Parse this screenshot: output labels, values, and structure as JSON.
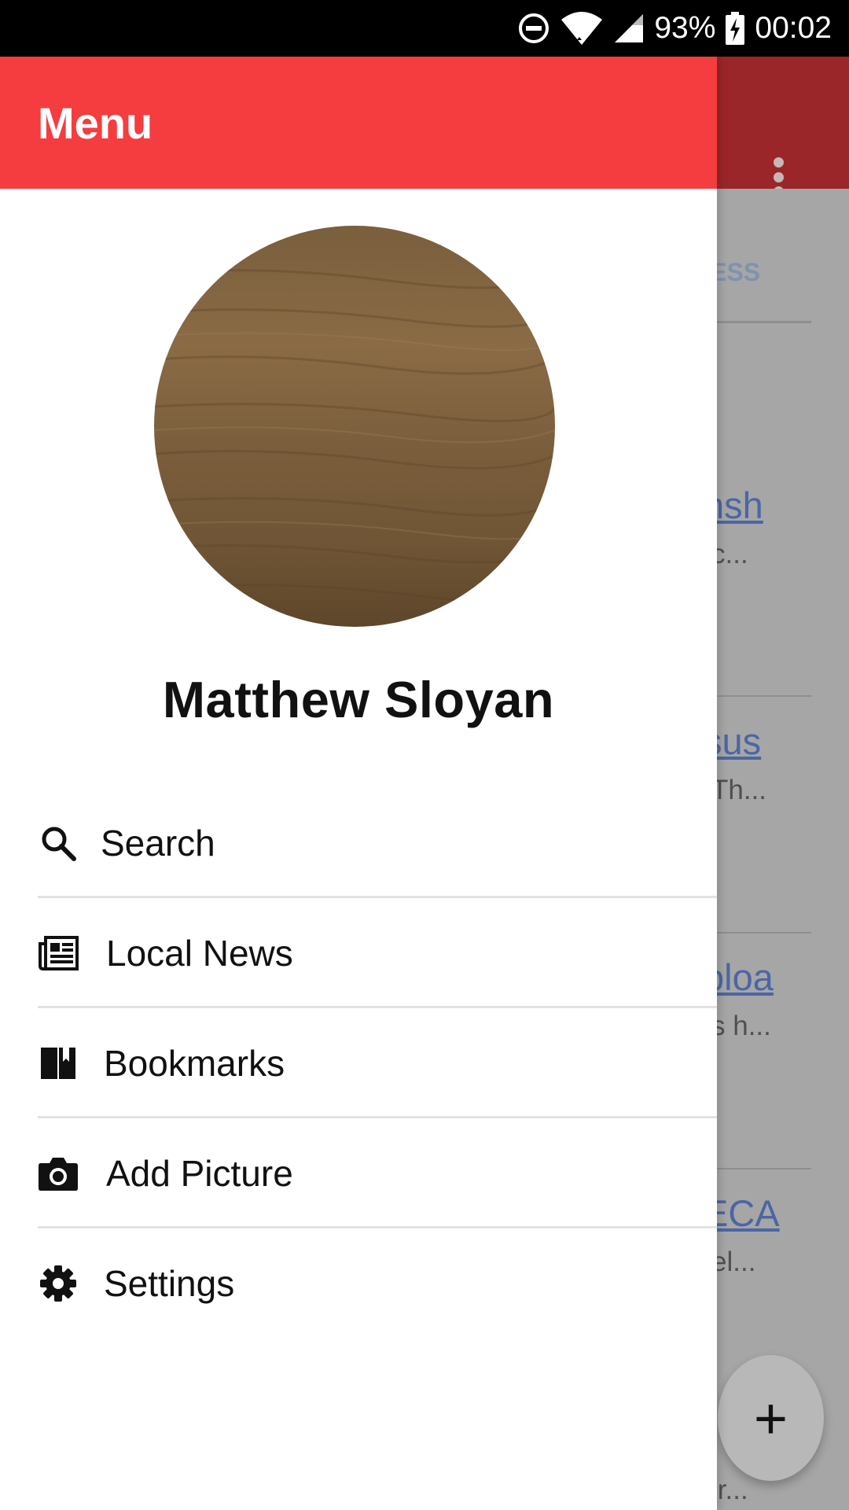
{
  "status_bar": {
    "battery": "93%",
    "time": "00:02",
    "icons": [
      "do-not-disturb-icon",
      "wifi-icon",
      "cell-signal-icon",
      "battery-charging-icon"
    ]
  },
  "drawer": {
    "title": "Menu",
    "profile_name": "Matthew Sloyan",
    "items": [
      {
        "label": "Search",
        "icon": "search-icon"
      },
      {
        "label": "Local News",
        "icon": "newspaper-icon"
      },
      {
        "label": "Bookmarks",
        "icon": "bookmarks-icon"
      },
      {
        "label": "Add Picture",
        "icon": "camera-icon"
      },
      {
        "label": "Settings",
        "icon": "gear-icon"
      }
    ]
  },
  "background": {
    "tab_fragment": "NESS",
    "articles": [
      {
        "title_fragment": "nsh",
        "snippet_fragment": "c..."
      },
      {
        "title_fragment": "sus",
        "snippet_fragment": "Th..."
      },
      {
        "title_fragment": "ploa",
        "snippet_fragment": "s h..."
      },
      {
        "title_fragment": "ECA",
        "snippet_fragment": "el..."
      }
    ],
    "last_snippet_fragment": "ir...",
    "fab_label": "+"
  },
  "colors": {
    "appbar": "#f53d3f",
    "appbar_dimmed": "#9b2629",
    "link": "#4b66a4",
    "scrim_background": "#a6a6a6"
  }
}
